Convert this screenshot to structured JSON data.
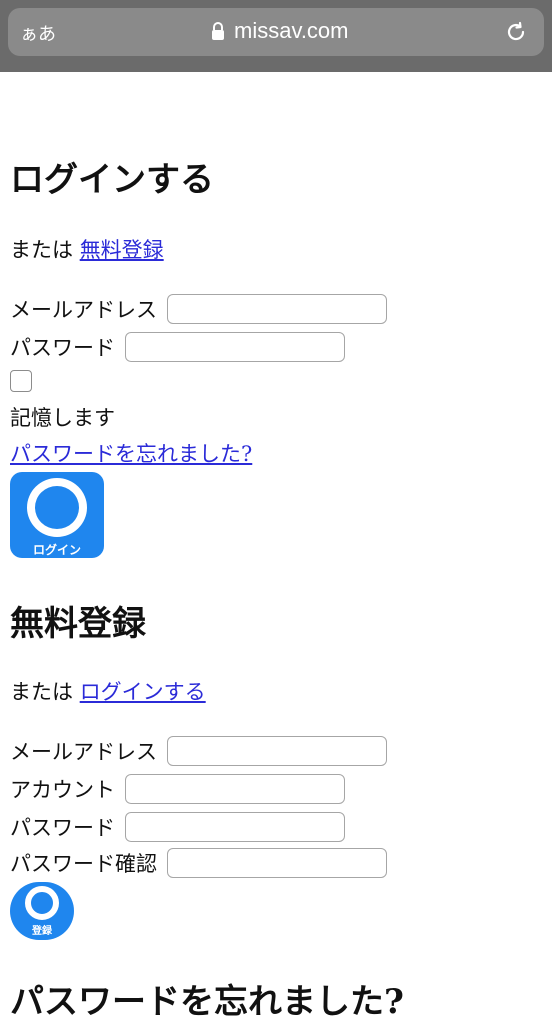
{
  "browser": {
    "aa_label": "ぁあ",
    "domain": "missav.com"
  },
  "login": {
    "title": "ログインする",
    "or_prefix": "または",
    "register_link": "無料登録",
    "email_label": "メールアドレス",
    "password_label": "パスワード",
    "remember_label": "記憶します",
    "forgot_link": "パスワードを忘れました?",
    "button_label": "ログイン"
  },
  "register": {
    "title": "無料登録",
    "or_prefix": "または",
    "login_link": "ログインする",
    "email_label": "メールアドレス",
    "account_label": "アカウント",
    "password_label": "パスワード",
    "password_confirm_label": "パスワード確認",
    "button_label": "登録"
  },
  "forgot": {
    "title": "パスワードを忘れました?"
  }
}
